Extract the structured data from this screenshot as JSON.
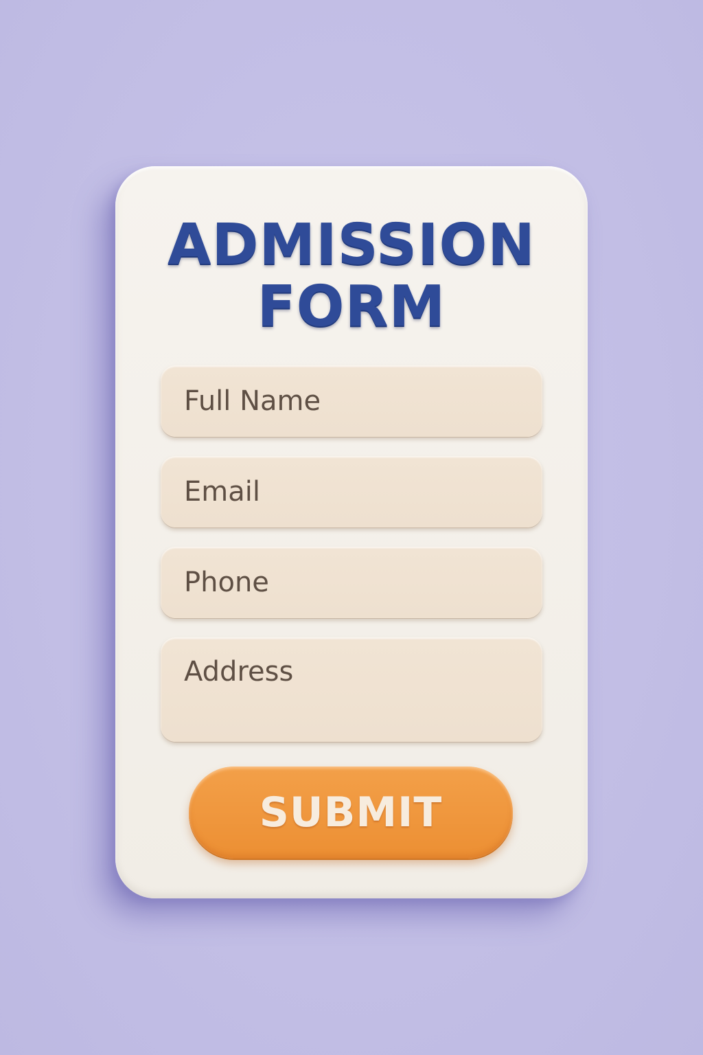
{
  "form": {
    "title_line1": "ADMISSION",
    "title_line2": "FORM",
    "fields": [
      {
        "label": "Full Name"
      },
      {
        "label": "Email"
      },
      {
        "label": "Phone"
      },
      {
        "label": "Address"
      }
    ],
    "submit_label": "SUBMIT"
  },
  "colors": {
    "background": "#c3bfe6",
    "card": "#f4f1eb",
    "title": "#2f4b98",
    "field": "#f0e2d1",
    "field_text": "#5e4f44",
    "submit": "#ef9539",
    "submit_text": "#f7ecde"
  }
}
